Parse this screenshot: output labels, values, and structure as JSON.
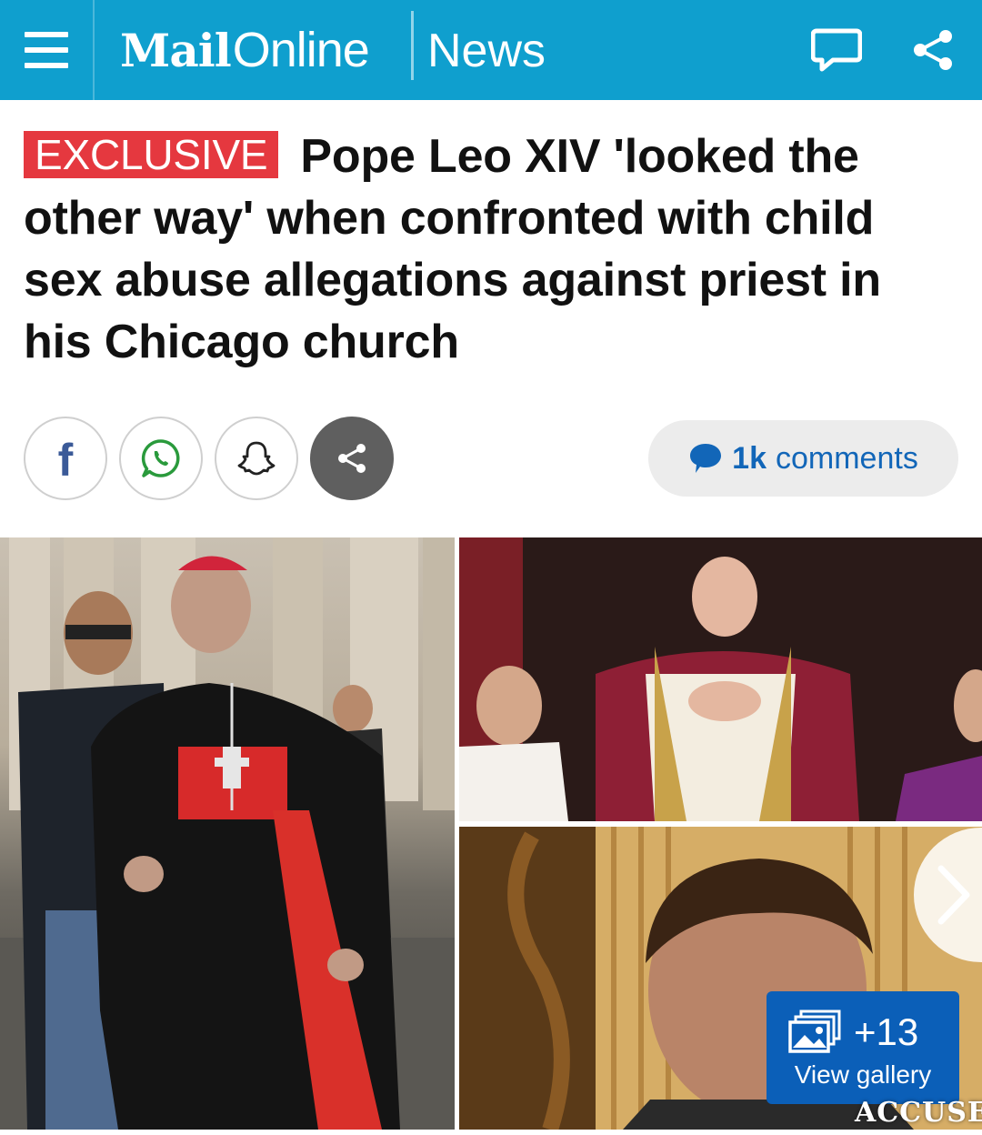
{
  "header": {
    "logo_mail": "Mail",
    "logo_online": "Online",
    "section": "News",
    "icons": {
      "menu": "hamburger-menu-icon",
      "comments": "comment-bubble-icon",
      "share": "share-icon"
    },
    "colors": {
      "background": "#0f9fce",
      "text": "#ffffff"
    }
  },
  "article": {
    "label": "EXCLUSIVE",
    "headline": "Pope Leo XIV 'looked the other way' when confronted with child sex abuse allegations against priest in his Chicago church",
    "colors": {
      "label_bg": "#e5383f"
    }
  },
  "share_row": {
    "buttons": [
      {
        "name": "facebook",
        "icon": "facebook-icon",
        "glyph": "f"
      },
      {
        "name": "whatsapp",
        "icon": "whatsapp-icon"
      },
      {
        "name": "snapchat",
        "icon": "snapchat-icon"
      },
      {
        "name": "more-share",
        "icon": "share-icon"
      }
    ],
    "comments_count": "1k",
    "comments_label": "comments",
    "comments_icon": "speech-bubble-icon",
    "colors": {
      "comments_text": "#1266b8",
      "pill_bg": "#ececec"
    }
  },
  "gallery": {
    "more_count": "+13",
    "view_label": "View gallery",
    "photo_caption_text": "ACCUSER",
    "icons": {
      "gallery": "photo-gallery-icon",
      "next": "chevron-right-icon"
    },
    "colors": {
      "button_bg": "#0b5fb8"
    }
  }
}
